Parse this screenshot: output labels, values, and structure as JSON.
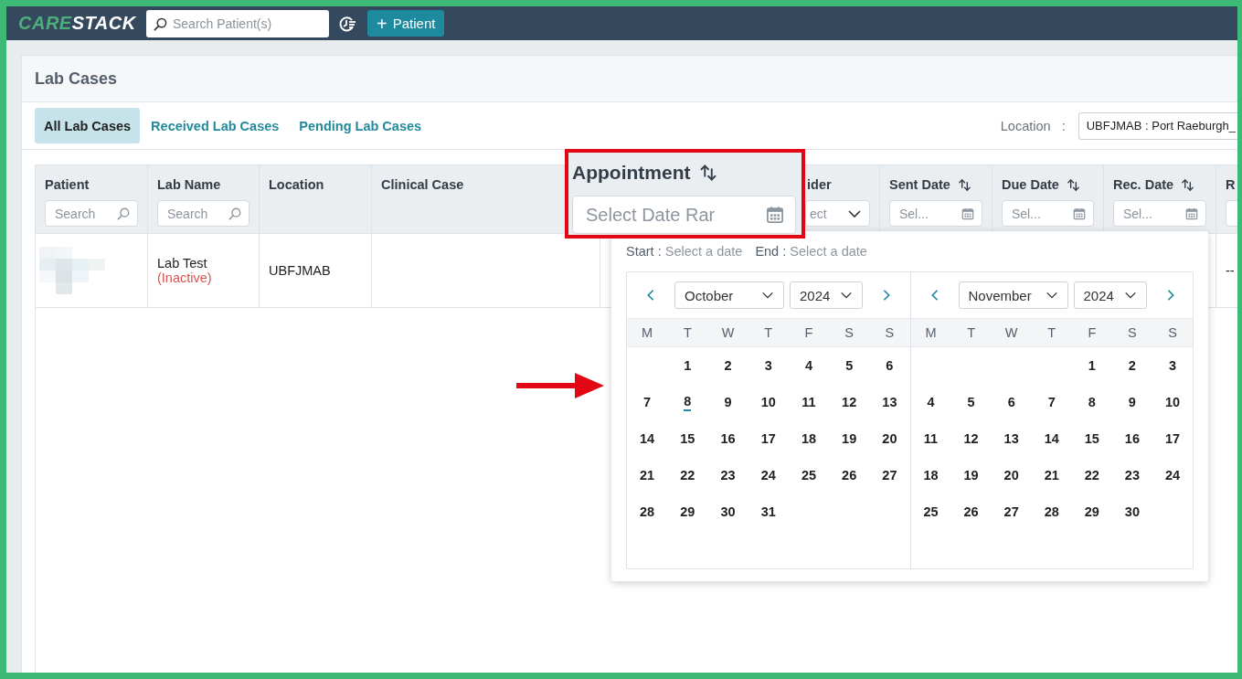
{
  "topbar": {
    "logo_primary": "CARE",
    "logo_secondary": "STACK",
    "search": {
      "placeholder": "Search Patient(s)"
    },
    "add_button": {
      "icon": "+",
      "label": "Patient"
    }
  },
  "page": {
    "title": "Lab Cases"
  },
  "tabs": [
    {
      "label": "All Lab Cases",
      "selected": true
    },
    {
      "label": "Received Lab Cases",
      "selected": false
    },
    {
      "label": "Pending Lab Cases",
      "selected": false
    }
  ],
  "location_filter": {
    "label": "Location",
    "separator": ":",
    "value": "UBFJMAB : Port Raeburgh_"
  },
  "table": {
    "columns": [
      {
        "label": "Patient",
        "kind": "search",
        "placeholder": "Search",
        "sortable": false,
        "highlighted": false
      },
      {
        "label": "Lab Name",
        "kind": "search",
        "placeholder": "Search",
        "sortable": false,
        "highlighted": false
      },
      {
        "label": "Location",
        "kind": "plain",
        "sortable": false,
        "highlighted": false
      },
      {
        "label": "Clinical Case",
        "kind": "plain",
        "sortable": false,
        "highlighted": false
      },
      {
        "label": "Appointment",
        "kind": "date",
        "placeholder": "Select Date Rar",
        "sortable": true,
        "highlighted": true
      },
      {
        "label": "ider",
        "kind": "select",
        "placeholder": "ect",
        "sortable": false,
        "highlighted": false
      },
      {
        "label": "Sent Date",
        "kind": "date",
        "placeholder": "Sel...",
        "sortable": true,
        "highlighted": false
      },
      {
        "label": "Due Date",
        "kind": "date",
        "placeholder": "Sel...",
        "sortable": true,
        "highlighted": false
      },
      {
        "label": "Rec. Date",
        "kind": "date",
        "placeholder": "Sel...",
        "sortable": true,
        "highlighted": false
      },
      {
        "label": "R",
        "kind": "stub",
        "sortable": false,
        "highlighted": false
      }
    ],
    "rows": [
      {
        "lab_name": "Lab Test",
        "lab_status": "(Inactive)",
        "location": "UBFJMAB",
        "column_10": "--"
      }
    ]
  },
  "date_picker": {
    "start_label": "Start :",
    "start_value": "Select a date",
    "end_label": "End :",
    "end_value": "Select a date",
    "months": [
      {
        "prev": true,
        "next": true,
        "month": "October",
        "year": "2024",
        "weekdays": [
          "M",
          "T",
          "W",
          "T",
          "F",
          "S",
          "S"
        ],
        "days": [
          {
            "kind": "blank"
          },
          {
            "kind": "day",
            "day": "1",
            "today": false
          },
          {
            "kind": "day",
            "day": "2",
            "today": false
          },
          {
            "kind": "day",
            "day": "3",
            "today": false
          },
          {
            "kind": "day",
            "day": "4",
            "today": false
          },
          {
            "kind": "day",
            "day": "5",
            "today": false
          },
          {
            "kind": "day",
            "day": "6",
            "today": false
          },
          {
            "kind": "day",
            "day": "7",
            "today": false
          },
          {
            "kind": "day",
            "day": "8",
            "today": true
          },
          {
            "kind": "day",
            "day": "9",
            "today": false
          },
          {
            "kind": "day",
            "day": "10",
            "today": false
          },
          {
            "kind": "day",
            "day": "11",
            "today": false
          },
          {
            "kind": "day",
            "day": "12",
            "today": false
          },
          {
            "kind": "day",
            "day": "13",
            "today": false
          },
          {
            "kind": "day",
            "day": "14",
            "today": false
          },
          {
            "kind": "day",
            "day": "15",
            "today": false
          },
          {
            "kind": "day",
            "day": "16",
            "today": false
          },
          {
            "kind": "day",
            "day": "17",
            "today": false
          },
          {
            "kind": "day",
            "day": "18",
            "today": false
          },
          {
            "kind": "day",
            "day": "19",
            "today": false
          },
          {
            "kind": "day",
            "day": "20",
            "today": false
          },
          {
            "kind": "day",
            "day": "21",
            "today": false
          },
          {
            "kind": "day",
            "day": "22",
            "today": false
          },
          {
            "kind": "day",
            "day": "23",
            "today": false
          },
          {
            "kind": "day",
            "day": "24",
            "today": false
          },
          {
            "kind": "day",
            "day": "25",
            "today": false
          },
          {
            "kind": "day",
            "day": "26",
            "today": false
          },
          {
            "kind": "day",
            "day": "27",
            "today": false
          },
          {
            "kind": "day",
            "day": "28",
            "today": false
          },
          {
            "kind": "day",
            "day": "29",
            "today": false
          },
          {
            "kind": "day",
            "day": "30",
            "today": false
          },
          {
            "kind": "day",
            "day": "31",
            "today": false
          }
        ]
      },
      {
        "prev": true,
        "next": true,
        "month": "November",
        "year": "2024",
        "weekdays": [
          "M",
          "T",
          "W",
          "T",
          "F",
          "S",
          "S"
        ],
        "days": [
          {
            "kind": "blank"
          },
          {
            "kind": "blank"
          },
          {
            "kind": "blank"
          },
          {
            "kind": "blank"
          },
          {
            "kind": "day",
            "day": "1",
            "today": false
          },
          {
            "kind": "day",
            "day": "2",
            "today": false
          },
          {
            "kind": "day",
            "day": "3",
            "today": false
          },
          {
            "kind": "day",
            "day": "4",
            "today": false
          },
          {
            "kind": "day",
            "day": "5",
            "today": false
          },
          {
            "kind": "day",
            "day": "6",
            "today": false
          },
          {
            "kind": "day",
            "day": "7",
            "today": false
          },
          {
            "kind": "day",
            "day": "8",
            "today": false
          },
          {
            "kind": "day",
            "day": "9",
            "today": false
          },
          {
            "kind": "day",
            "day": "10",
            "today": false
          },
          {
            "kind": "day",
            "day": "11",
            "today": false
          },
          {
            "kind": "day",
            "day": "12",
            "today": false
          },
          {
            "kind": "day",
            "day": "13",
            "today": false
          },
          {
            "kind": "day",
            "day": "14",
            "today": false
          },
          {
            "kind": "day",
            "day": "15",
            "today": false
          },
          {
            "kind": "day",
            "day": "16",
            "today": false
          },
          {
            "kind": "day",
            "day": "17",
            "today": false
          },
          {
            "kind": "day",
            "day": "18",
            "today": false
          },
          {
            "kind": "day",
            "day": "19",
            "today": false
          },
          {
            "kind": "day",
            "day": "20",
            "today": false
          },
          {
            "kind": "day",
            "day": "21",
            "today": false
          },
          {
            "kind": "day",
            "day": "22",
            "today": false
          },
          {
            "kind": "day",
            "day": "23",
            "today": false
          },
          {
            "kind": "day",
            "day": "24",
            "today": false
          },
          {
            "kind": "day",
            "day": "25",
            "today": false
          },
          {
            "kind": "day",
            "day": "26",
            "today": false
          },
          {
            "kind": "day",
            "day": "27",
            "today": false
          },
          {
            "kind": "day",
            "day": "28",
            "today": false
          },
          {
            "kind": "day",
            "day": "29",
            "today": false
          },
          {
            "kind": "day",
            "day": "30",
            "today": false
          }
        ]
      }
    ]
  },
  "annotations": {
    "arrow": true
  }
}
